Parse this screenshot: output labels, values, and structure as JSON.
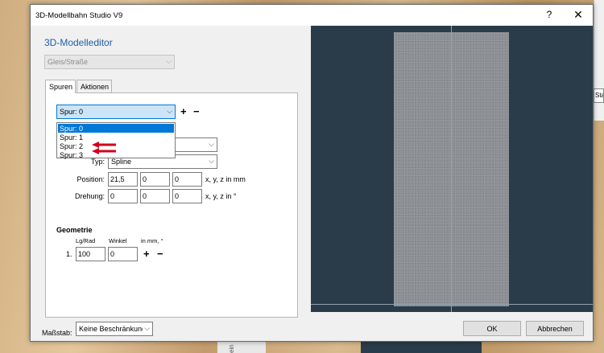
{
  "window": {
    "title": "3D-Modellbahn Studio V9",
    "help_glyph": "?",
    "close_glyph": "✕"
  },
  "editor": {
    "heading": "3D-Modelleditor",
    "category_combo": "Gleis/Straße"
  },
  "tabs": [
    {
      "label": "Spuren",
      "active": true
    },
    {
      "label": "Aktionen",
      "active": false
    }
  ],
  "spur": {
    "current": "Spur: 0",
    "add_glyph": "+",
    "remove_glyph": "−",
    "options": [
      "Spur: 0",
      "Spur: 1",
      "Spur: 2",
      "Spur: 3"
    ],
    "selected_index": 0,
    "highlighted_options": [
      "Spur: 2",
      "Spur: 3"
    ]
  },
  "fields": {
    "typ_label": "Typ:",
    "typ_value": "Spline",
    "position_label": "Position:",
    "position_x": "21,5",
    "position_y": "0",
    "position_z": "0",
    "position_unit": "x, y, z in mm",
    "drehung_label": "Drehung:",
    "drehung_x": "0",
    "drehung_y": "0",
    "drehung_z": "0",
    "drehung_unit": "x, y, z in °"
  },
  "geometrie": {
    "heading": "Geometrie",
    "col_lgrad": "Lg/Rad",
    "col_winkel": "Winkel",
    "col_unit": "in mm, °",
    "row_index": "1.",
    "row_lgrad": "100",
    "row_winkel": "0",
    "add_glyph": "+",
    "remove_glyph": "−"
  },
  "footer": {
    "massstab_label": "Maßstab:",
    "massstab_value": "Keine Beschränkung",
    "ok_label": "OK",
    "cancel_label": "Abbrechen"
  },
  "background": {
    "right_field_text": "Star",
    "bottom_text": "ein"
  },
  "colors": {
    "heading_blue": "#1e5fa8",
    "viewport_bg": "#2a3c49",
    "selection_blue": "#0078d7",
    "annotation_red": "#d0021b"
  }
}
